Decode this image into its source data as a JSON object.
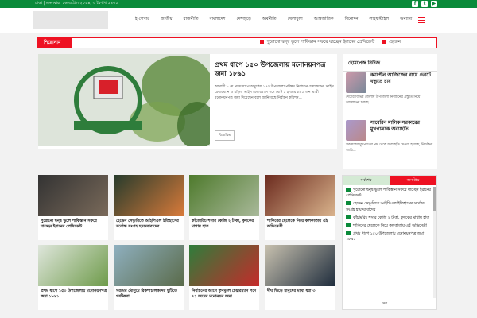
{
  "topbar": {
    "date": "ঢাকা | মঙ্গলবার, ১৬ এপ্রিল ২০২৪, ৩ বৈশাখ ১৪৩১",
    "social": [
      "facebook",
      "twitter",
      "youtube"
    ]
  },
  "nav": {
    "items": [
      "ই-পেপার",
      "জাতীয়",
      "রাজনীতি",
      "বাংলাদেশ",
      "দেশজুড়ে",
      "অর্থনীতি",
      "খেলাধুলা",
      "আন্তর্জাতিক",
      "বিনোদন",
      "লাইফস্টাইল",
      "অন্যান্য"
    ]
  },
  "ticker": {
    "label": "শিরোনাম",
    "items": [
      "পুরোনো দ্বন্দ্ব ভুলে পাকিস্তান সফরে যাচ্ছেন ইরানের প্রেসিডেন্ট",
      "হেডেন"
    ]
  },
  "hero": {
    "title": "প্রথম ধাপে ১৫০ উপজেলায় মনোনয়নপত্র জমা ১৮৯১",
    "body": "আগামী ৮ মে প্রথম ধাপে অনুষ্ঠেয় ১৫০ উপজেলা পরিষদ নির্বাচনে চেয়ারম্যান, ভাইস চেয়ারম্যান ও মহিলা ভাইস চেয়ারম্যান পদে মোট ১ হাজার ৮৯১ জন প্রার্থী মনোনয়নপত্র জমা দিয়েছেন বলে জানিয়েছে নির্বাচন কমিশন...",
    "more": "বিস্তারিত"
  },
  "hot": {
    "head": "হোমপেজ নিউজ",
    "items": [
      {
        "title": "ক্যাপ্টেন আজিজের রায়ে ভোটে বন্ধুতে চায়",
        "summary": "দেশের বিভিন্ন জেলায় উপজেলা নির্বাচনের প্রস্তুতি নিয়ে আলোচনা চলছে..."
      },
      {
        "title": "সাবেরিন মালিক সরকারের মুখপাত্রকে অব্যাহতি",
        "summary": "সরকারের মুখপাত্রের পদ থেকে অব্যাহতি দেওয়া হয়েছে, নির্দেশনা জারি..."
      }
    ]
  },
  "cards_row1": [
    {
      "title": "পুরোনো দ্বন্দ্ব ভুলে পাকিস্তান সফরে যাচ্ছেন ইরানের প্রেসিডেন্ট"
    },
    {
      "title": "হেডেন সেঞ্চুরিতে আইপিএল ইতিহাসের সর্বোচ্চ সংগ্রহ হায়দরাবাদের"
    },
    {
      "title": "কাঁচামরিচ শসার কেজি ২ টাকা, কৃষকের মাথায় হাত"
    },
    {
      "title": "শাকিবের ছেলেকে নিয়ে কলকাতায় এই অভিনেত্রী"
    }
  ],
  "cards_row2": [
    {
      "title": "প্রথম ধাপে ১৫০ উপজেলায় মনোনয়নপত্র জমা ১৮৯১"
    },
    {
      "title": "গরমের মৌসুমে রিকশাচালকদের ছুটিতে পর্যটকরা"
    },
    {
      "title": "নির্বাচনের আগে তৃণমূলে চেয়ারম্যান পদে ৭১ জনের মনোনয়ন জমা"
    },
    {
      "title": "দীর্ঘ ভিড়ে মানুষের মাথা ধরা ৩"
    }
  ],
  "tabs": {
    "tab1": "সর্বশেষ",
    "tab2": "জনপ্রিয়",
    "items": [
      "পুরোনো দ্বন্দ্ব ভুলে পাকিস্তান সফরে যাচ্ছেন ইরানের প্রেসিডেন্ট",
      "হেডেন সেঞ্চুরিতে আইপিএল ইতিহাসের সর্বোচ্চ সংগ্রহ হায়দরাবাদের",
      "কাঁচামরিচ শসার কেজি ২ টাকা, কৃষকের মাথায় হাত",
      "শাকিবের ছেলেকে নিয়ে কলকাতায় এই অভিনেত্রী",
      "প্রথম ধাপে ১৫০ উপজেলায় মনোনয়নপত্র জমা ১৮৯১"
    ],
    "more": "সব"
  },
  "colors": {
    "accent": "#0a8a3a",
    "alert": "#e11122"
  }
}
